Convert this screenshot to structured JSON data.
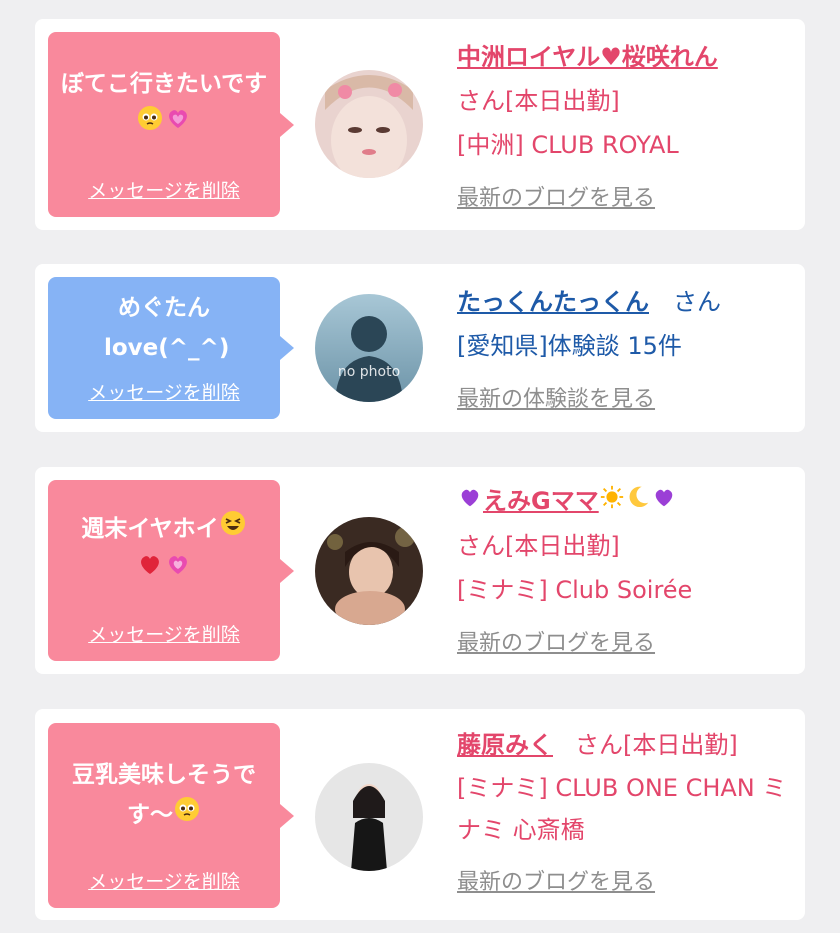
{
  "cards": [
    {
      "message": "ぼてこ行きたいです",
      "message_emoji": [
        "pleading-face",
        "sparkling-heart"
      ],
      "delete_label": "メッセージを削除",
      "name": "中洲ロイヤル♥桜咲れん",
      "suffix": "さん[本日出勤]",
      "detail": "[中洲] CLUB ROYAL",
      "link": "最新のブログを見る"
    },
    {
      "message": "めぐたん love(^_^)",
      "delete_label": "メッセージを削除",
      "name": "たっくんたっくん",
      "suffix": "さん",
      "detail": "[愛知県]体験談 15件",
      "avatar_text": "no photo",
      "link": "最新の体験談を見る"
    },
    {
      "message": "週末イヤホイ",
      "message_emoji": [
        "grinning-squinting-face",
        "red-heart",
        "growing-heart"
      ],
      "delete_label": "メッセージを削除",
      "name": "えみGママ",
      "name_emoji": [
        "purple-heart",
        "sun",
        "crescent-moon",
        "purple-heart"
      ],
      "suffix": "さん[本日出勤]",
      "detail": "[ミナミ] Club Soirée",
      "link": "最新のブログを見る"
    },
    {
      "message": "豆乳美味しそうです〜",
      "message_emoji": [
        "pleading-face"
      ],
      "delete_label": "メッセージを削除",
      "name": "藤原みく",
      "suffix": "さん[本日出勤]",
      "detail": "[ミナミ] CLUB ONE CHAN ミナミ 心斎橋",
      "link": "最新のブログを見る"
    }
  ],
  "colors": {
    "pink_bubble": "#f9899c",
    "blue_bubble": "#86b3f5",
    "pink_text": "#e3466b",
    "blue_text": "#1e5aa8",
    "link_gray": "#8e8e8e",
    "background": "#efeff1"
  }
}
